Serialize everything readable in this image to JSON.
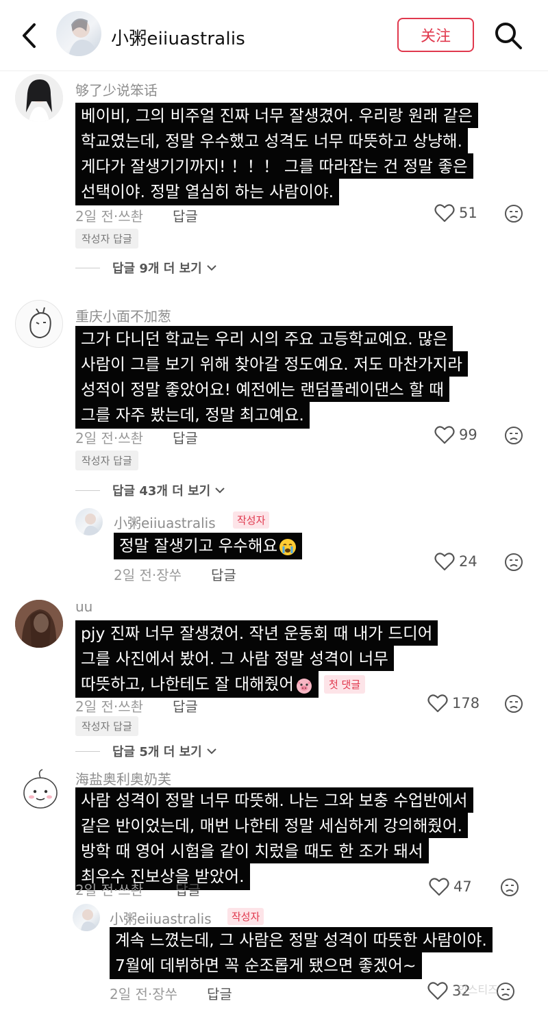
{
  "header": {
    "username": "小粥eiiuastralis",
    "follow_label": "关注"
  },
  "comments": [
    {
      "user": "够了少说笨话",
      "lines": [
        "베이비, 그의 비주얼 진짜 너무 잘생겼어. 우리랑 원래 같은",
        "학교였는데, 정말 우수했고 성격도 너무 따뜻하고 상냥해.",
        "게다가 잘생기기까지! ！！！ 그를 따라잡는 건 정말 좋은",
        "선택이야. 정말 열심히 하는 사람이야."
      ],
      "meta": "2일 전·쓰촨",
      "reply_label": "답글",
      "likes": "51",
      "author_reply_tag": "작성자 답글",
      "more_replies": "답글 9개 더 보기"
    },
    {
      "user": "重庆小面不加葱",
      "lines": [
        "그가 다니던 학교는 우리 시의 주요 고등학교예요. 많은",
        "사람이 그를 보기 위해 찾아갈 정도예요. 저도 마찬가지라",
        "성적이 정말 좋았어요! 예전에는 랜덤플레이댄스 할 때",
        "그를 자주 봤는데, 정말 최고예요."
      ],
      "meta": "2일 전·쓰촨",
      "reply_label": "답글",
      "likes": "99",
      "author_reply_tag": "작성자 답글",
      "more_replies": "답글 43개 더 보기",
      "reply": {
        "user": "小粥eiiuastralis",
        "badge": "작성자",
        "text": "정말 잘생기고 우수해요",
        "meta": "2일 전·장쑤",
        "reply_label": "답글",
        "likes": "24"
      }
    },
    {
      "user": "uu",
      "lines": [
        "pjy 진짜 너무 잘생겼어. 작년 운동회 때 내가 드디어",
        "그를 사진에서 봤어. 그 사람 정말 성격이 너무",
        "따뜻하고, 나한테도 잘 대해줬어"
      ],
      "first_comment_tag": "첫 댓글",
      "meta": "2일 전·쓰촨",
      "reply_label": "답글",
      "likes": "178",
      "author_reply_tag": "작성자 답글",
      "more_replies": "답글 5개 더 보기"
    },
    {
      "user": "海盐奥利奥奶芙",
      "lines": [
        "사람 성격이 정말 너무 따뜻해. 나는 그와 보충 수업반에서",
        "같은 반이었는데, 매번 나한테 정말 세심하게 강의해줬어.",
        "방학 때 영어 시험을 같이 치렀을 때도 한 조가 돼서",
        "최우수 진보상을 받았어."
      ],
      "meta": "2일 전·쓰촨",
      "reply_label": "답글",
      "likes": "47",
      "reply": {
        "user": "小粥eiiuastralis",
        "badge": "작성자",
        "lines": [
          "계속 느꼈는데, 그 사람은 정말 성격이 따뜻한 사람이야.",
          "7월에 데뷔하면 꼭 순조롭게 됐으면 좋겠어~"
        ],
        "meta": "2일 전·장쑤",
        "reply_label": "답글",
        "likes": "32"
      }
    }
  ],
  "watermark": "인스티즈"
}
